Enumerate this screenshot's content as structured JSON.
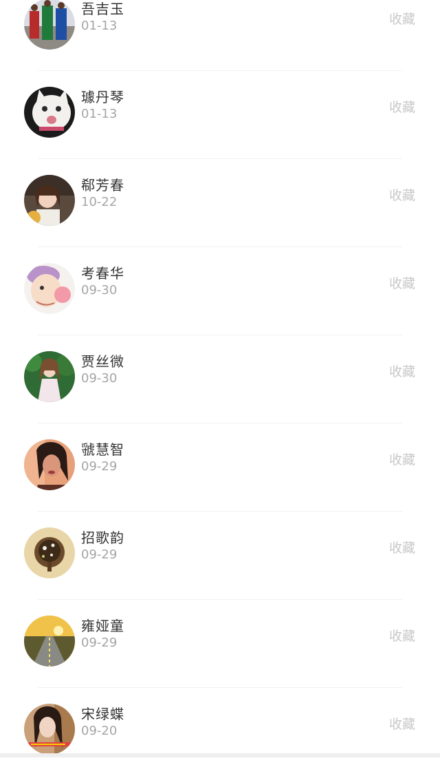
{
  "favorites": {
    "items": [
      {
        "name": "吾吉玉",
        "date": "01-13",
        "action": "收藏",
        "avatar": "basketball-players-avatar"
      },
      {
        "name": "璩丹琴",
        "date": "01-13",
        "action": "收藏",
        "avatar": "white-cat-avatar"
      },
      {
        "name": "郗芳春",
        "date": "10-22",
        "action": "收藏",
        "avatar": "woman-portrait-avatar"
      },
      {
        "name": "考春华",
        "date": "09-30",
        "action": "收藏",
        "avatar": "cartoon-character-avatar"
      },
      {
        "name": "贾丝微",
        "date": "09-30",
        "action": "收藏",
        "avatar": "girl-in-forest-avatar"
      },
      {
        "name": "虢慧智",
        "date": "09-29",
        "action": "收藏",
        "avatar": "dark-hair-woman-avatar"
      },
      {
        "name": "招歌韵",
        "date": "09-29",
        "action": "收藏",
        "avatar": "illustrated-tree-avatar"
      },
      {
        "name": "雍娅童",
        "date": "09-29",
        "action": "收藏",
        "avatar": "sunset-road-avatar"
      },
      {
        "name": "宋绿蝶",
        "date": "09-20",
        "action": "收藏",
        "avatar": "woman-selfie-avatar"
      }
    ]
  }
}
